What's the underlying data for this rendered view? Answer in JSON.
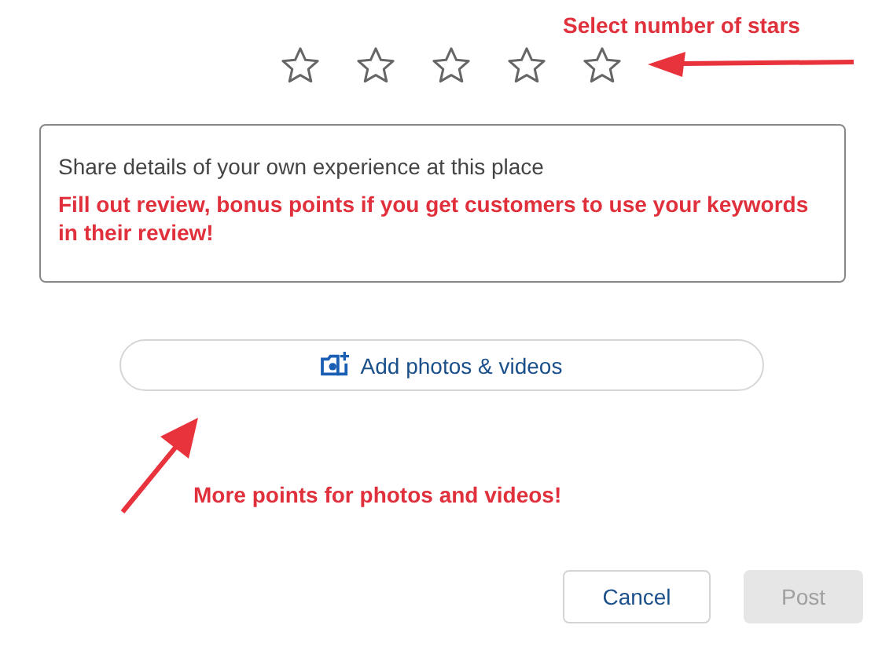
{
  "rating": {
    "stars": 0
  },
  "review": {
    "placeholder": "Share details of your own experience at this place"
  },
  "add_media_button": {
    "label": "Add photos & videos"
  },
  "buttons": [
    {
      "label": "Cancel",
      "disabled": false
    },
    {
      "label": "Post",
      "disabled": true
    }
  ],
  "annotations": [
    {
      "kind": "stars",
      "text": "Select number of stars"
    },
    {
      "kind": "review",
      "text": "Fill out review, bonus points if you get customers to use your keywords in their review!"
    },
    {
      "kind": "media",
      "text": "More points for photos and videos!"
    }
  ]
}
